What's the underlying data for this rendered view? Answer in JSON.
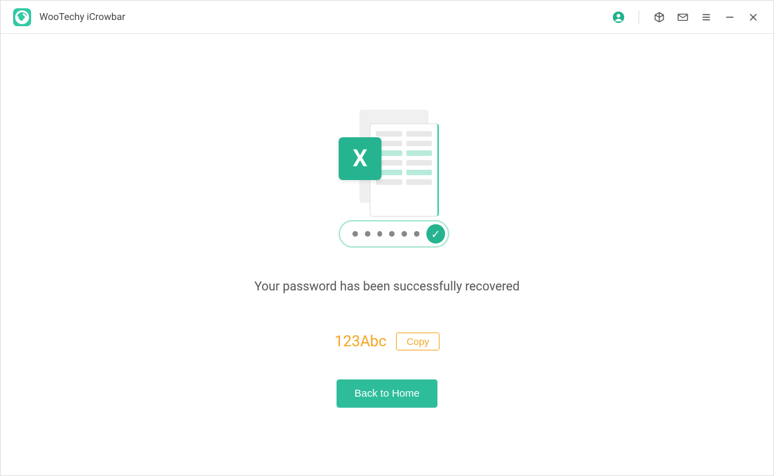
{
  "app": {
    "title": "WooTechy iCrowbar"
  },
  "titlebar": {
    "icons": {
      "account": "account-icon",
      "cube": "cube-icon",
      "mail": "mail-icon",
      "menu": "menu-icon",
      "minimize": "minimize-icon",
      "close": "close-icon"
    }
  },
  "main": {
    "message": "Your password has been successfully recovered",
    "password": "123Abc",
    "copy_label": "Copy",
    "home_label": "Back to Home",
    "illustration": {
      "badge_letter": "X",
      "dots_count": 6
    }
  },
  "colors": {
    "accent": "#2ebd9b",
    "warning": "#f5a523"
  }
}
